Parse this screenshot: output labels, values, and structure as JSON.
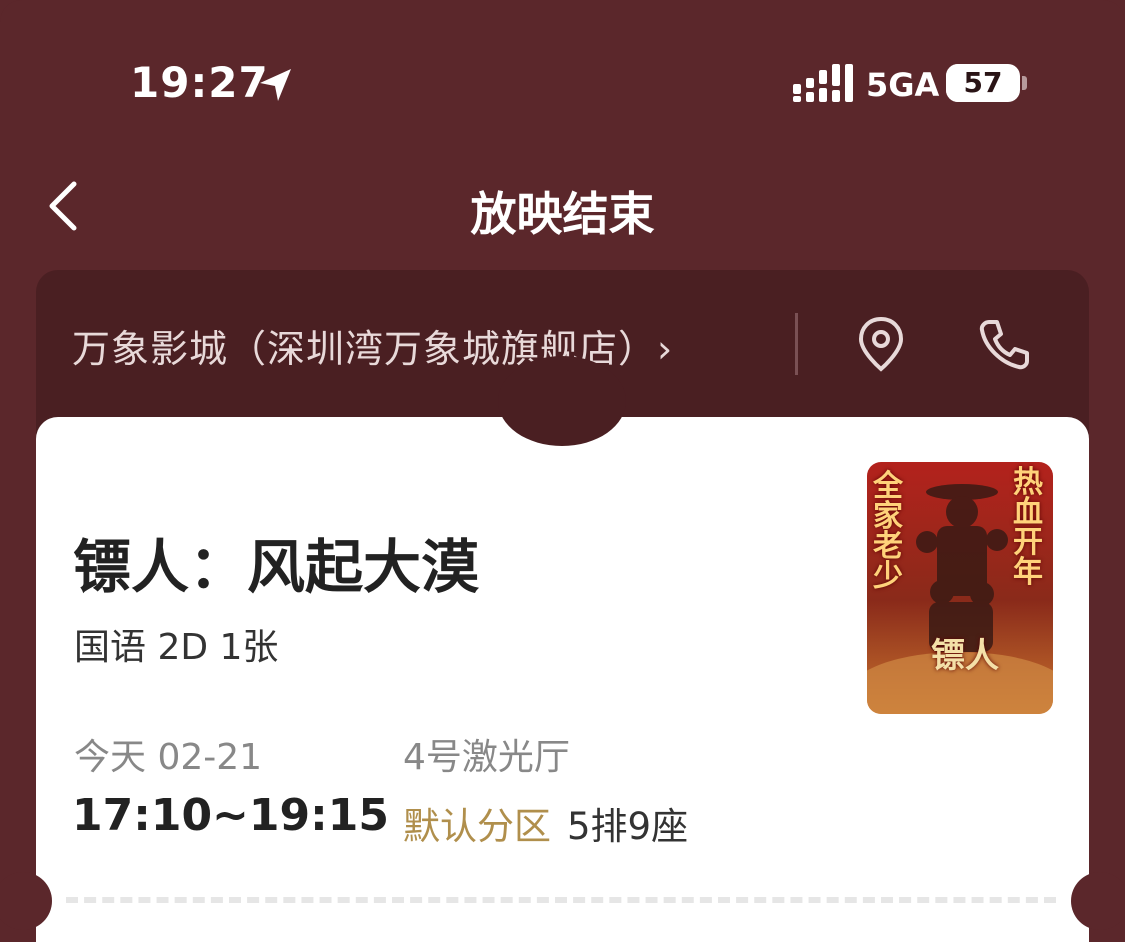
{
  "status_bar": {
    "time": "19:27",
    "network": "5GA",
    "battery": "57",
    "battery_level": 0.57
  },
  "nav": {
    "title": "放映结束"
  },
  "cinema": {
    "name": "万象影城（深圳湾万象城旗舰店）›"
  },
  "movie": {
    "title": "镖人：风起大漠",
    "format": "国语 2D 1张",
    "date": "今天 02-21",
    "time": "17:10~19:15",
    "hall": "4号激光厅",
    "zone": "默认分区",
    "seat": "5排9座"
  },
  "poster": {
    "left_text": "全家老少",
    "right_text": "热血开年",
    "logo": "镖人"
  },
  "colors": {
    "background": "#5b272b",
    "cinema_bar": "#4a1f22",
    "zone_accent": "#b08f4c"
  }
}
